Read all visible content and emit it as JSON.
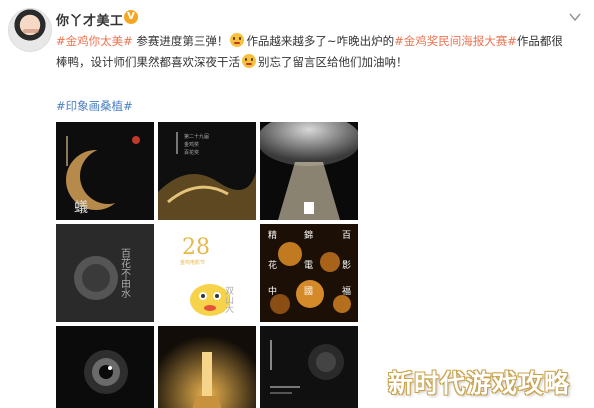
{
  "post": {
    "username": "你丫才美工",
    "verified_badge": "V",
    "text_segments": [
      {
        "kind": "hashtag",
        "text": "#金鸡你太美#"
      },
      {
        "kind": "plain",
        "text": " 参赛进度第三弹！"
      },
      {
        "kind": "emoji",
        "text": ""
      },
      {
        "kind": "plain",
        "text": "作品越来越多了~咋晚出炉的"
      },
      {
        "kind": "hashtag",
        "text": "#金鸡奖民间海报大赛#"
      },
      {
        "kind": "plain",
        "text": "作品都很棒鸭，设计师们果然都喜欢深夜干活"
      },
      {
        "kind": "emoji",
        "text": ""
      },
      {
        "kind": "plain",
        "text": "别忘了留言区给他们加油呐！"
      }
    ],
    "tag": "#印象画桑植#"
  },
  "images": {
    "tile2_caption": "第二十九届\n金鸡奖\n百花奖",
    "tile5_number": "28",
    "tile6_chars": [
      "百",
      "精",
      "錦",
      "花",
      "電",
      "影",
      "中",
      "國",
      "福",
      "節",
      "建"
    ],
    "tile4_text": "百花不由水"
  },
  "watermark": "新时代游戏攻略",
  "icons": {
    "menu": "chevron-down-icon",
    "verified": "verified-badge-icon"
  }
}
